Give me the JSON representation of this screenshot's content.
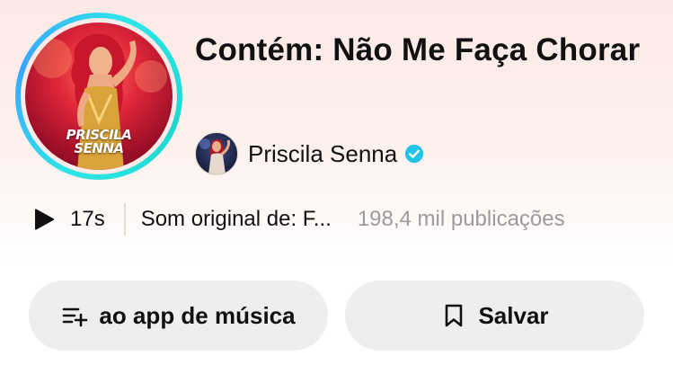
{
  "sound": {
    "title": "Contém: Não Me Faça Chorar",
    "cover_text_line1": "PRISCILA",
    "cover_text_line2": "SENNA"
  },
  "artist": {
    "name": "Priscila Senna",
    "verified": true
  },
  "meta": {
    "duration": "17s",
    "original_sound": "Som original de: F...",
    "posts_count": "198,4 mil publicações"
  },
  "actions": {
    "music_app_label": "ao app de música",
    "save_label": "Salvar"
  },
  "colors": {
    "ring_accent": "#2ee6e6",
    "verified": "#20c4e8",
    "button_bg": "#eeeeee",
    "muted_text": "#9b9b9b"
  },
  "icons": {
    "play": "play-icon",
    "verified": "verified-badge-icon",
    "add_to_music_app": "playlist-add-icon",
    "save": "bookmark-icon"
  }
}
